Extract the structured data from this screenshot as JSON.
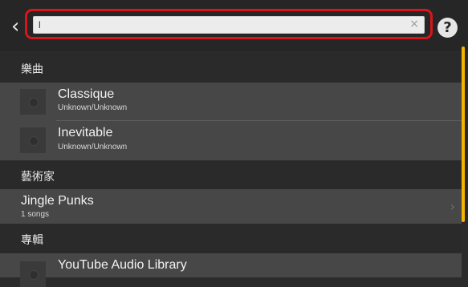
{
  "search": {
    "value": "l",
    "clear_glyph": "×"
  },
  "header": {
    "back_glyph": "‹",
    "help_glyph": "?"
  },
  "sections": {
    "songs": {
      "label": "樂曲"
    },
    "artists": {
      "label": "藝術家"
    },
    "albums": {
      "label": "專輯"
    }
  },
  "songs": [
    {
      "title": "Classique",
      "subtitle": "Unknown/Unknown"
    },
    {
      "title": "Inevitable",
      "subtitle": "Unknown/Unknown"
    }
  ],
  "artists": [
    {
      "title": "Jingle Punks",
      "subtitle": "1 songs",
      "chevron": "›"
    }
  ],
  "albums": [
    {
      "title": "YouTube Audio Library"
    }
  ],
  "icons": {
    "back": "back-icon",
    "help": "help-icon",
    "clear": "clear-icon",
    "chevron": "chevron-right-icon",
    "thumbnail": "album-art-placeholder"
  },
  "colors": {
    "accent": "#f5b400",
    "highlight_border": "#d9151b"
  }
}
